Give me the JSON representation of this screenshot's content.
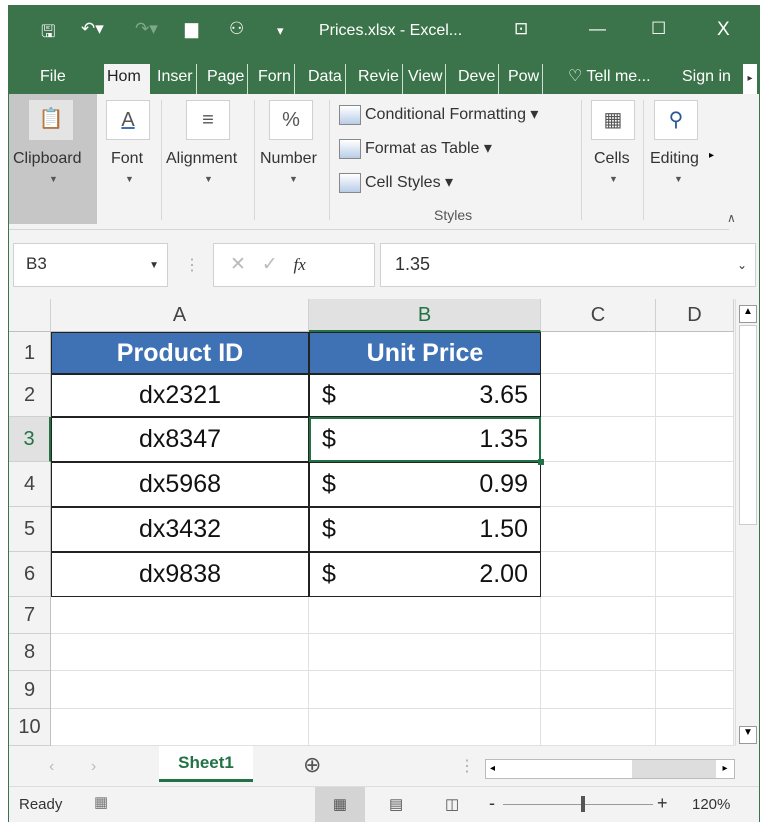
{
  "title_bar": {
    "file_title": "Prices.xlsx - Excel...",
    "minimize": "—",
    "maximize": "☐",
    "close": "X"
  },
  "tabs": [
    "File",
    "Hom",
    "Inser",
    "Page",
    "Forn",
    "Data",
    "Revie",
    "View",
    "Deve",
    "Pow"
  ],
  "tell_me": "Tell me...",
  "sign_in": "Sign in",
  "ribbon": {
    "clipboard": "Clipboard",
    "font": "Font",
    "alignment": "Alignment",
    "number": "Number",
    "conditional_formatting": "Conditional Formatting",
    "format_as_table": "Format as Table",
    "cell_styles": "Cell Styles",
    "styles": "Styles",
    "cells": "Cells",
    "editing": "Editing"
  },
  "formula_bar": {
    "name_box": "B3",
    "fx": "fx",
    "value": "1.35"
  },
  "columns": [
    "A",
    "B",
    "C",
    "D"
  ],
  "rows": [
    "1",
    "2",
    "3",
    "4",
    "5",
    "6",
    "7",
    "8",
    "9",
    "10"
  ],
  "table": {
    "headers": [
      "Product ID",
      "Unit Price"
    ],
    "data": [
      {
        "id": "dx2321",
        "cur": "$",
        "price": "3.65"
      },
      {
        "id": "dx8347",
        "cur": "$",
        "price": "1.35"
      },
      {
        "id": "dx5968",
        "cur": "$",
        "price": "0.99"
      },
      {
        "id": "dx3432",
        "cur": "$",
        "price": "1.50"
      },
      {
        "id": "dx9838",
        "cur": "$",
        "price": "2.00"
      }
    ]
  },
  "sheet_tab": "Sheet1",
  "status": {
    "ready": "Ready",
    "zoom": "120%"
  }
}
